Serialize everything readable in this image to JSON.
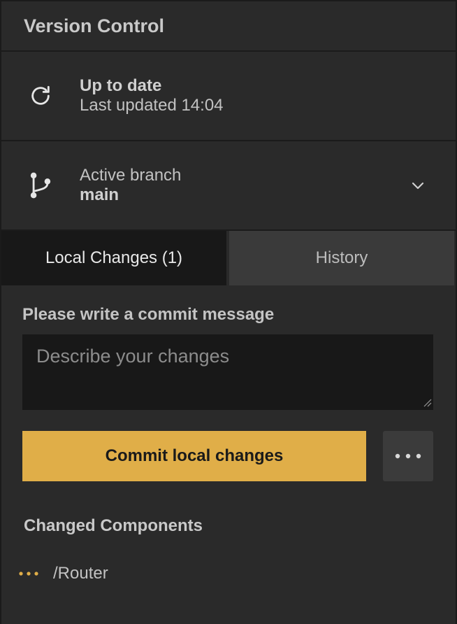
{
  "header": {
    "title": "Version Control"
  },
  "status": {
    "title": "Up to date",
    "subtitle": "Last updated 14:04",
    "icon": "refresh-icon"
  },
  "branch": {
    "label": "Active branch",
    "name": "main",
    "icon": "git-branch-icon",
    "dropdown_icon": "chevron-down-icon"
  },
  "tabs": [
    {
      "label": "Local Changes (1)",
      "active": true
    },
    {
      "label": "History",
      "active": false
    }
  ],
  "commit": {
    "label": "Please write a commit message",
    "placeholder": "Describe your changes",
    "value": "",
    "button_label": "Commit local changes",
    "more_icon": "more-horizontal-icon"
  },
  "changed_components": {
    "title": "Changed Components",
    "items": [
      {
        "name": "/Router",
        "status_icon": "modified-dots-icon",
        "status_color": "#e0ae48"
      }
    ]
  },
  "colors": {
    "accent": "#e0ae48",
    "background": "#2a2a2a",
    "input_background": "#181818"
  }
}
